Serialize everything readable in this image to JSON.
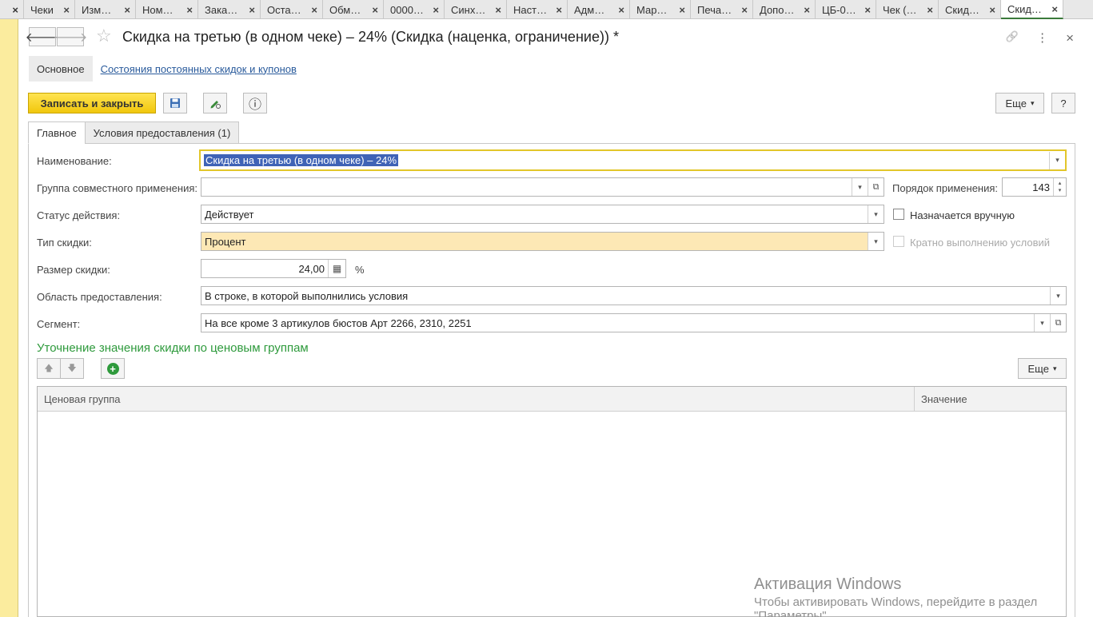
{
  "window_tabs": [
    {
      "label": "Чеки",
      "active": false
    },
    {
      "label": "Изм…",
      "active": false
    },
    {
      "label": "Ном…",
      "active": false
    },
    {
      "label": "Зака…",
      "active": false
    },
    {
      "label": "Оста…",
      "active": false
    },
    {
      "label": "Обм…",
      "active": false
    },
    {
      "label": "0000…",
      "active": false
    },
    {
      "label": "Синх…",
      "active": false
    },
    {
      "label": "Наст…",
      "active": false
    },
    {
      "label": "Адм…",
      "active": false
    },
    {
      "label": "Мар…",
      "active": false
    },
    {
      "label": "Печа…",
      "active": false
    },
    {
      "label": "Допо…",
      "active": false
    },
    {
      "label": "ЦБ-0…",
      "active": false
    },
    {
      "label": "Чек (…",
      "active": false
    },
    {
      "label": "Скид…",
      "active": false
    },
    {
      "label": "Скид…",
      "active": true
    }
  ],
  "tab_close_glyph": "×",
  "header": {
    "back_glyph": "🡐",
    "forward_glyph": "🡒",
    "star_glyph": "☆",
    "title": "Скидка  на третью (в одном чеке) – 24% (Скидка (наценка, ограничение)) *",
    "link_glyph": "🔗",
    "menu_glyph": "⋮",
    "close_glyph": "×"
  },
  "section_tabs": [
    {
      "label": "Основное",
      "active": true
    },
    {
      "label": "Состояния постоянных скидок и купонов",
      "active": false
    }
  ],
  "toolbar": {
    "save_close_label": "Записать и закрыть",
    "save_icon": "floppy-disk-icon",
    "edit_icon": "pen-icon",
    "info_glyph": "ⓘ",
    "more_label": "Еще",
    "help_label": "?"
  },
  "form_tabs": [
    {
      "label": "Главное",
      "active": true
    },
    {
      "label": "Условия предоставления (1)",
      "active": false
    }
  ],
  "fields": {
    "name": {
      "label": "Наименование:",
      "value": "Скидка  на третью (в одном чеке) – 24%"
    },
    "group": {
      "label": "Группа совместного применения:",
      "value": ""
    },
    "order": {
      "label": "Порядок применения:",
      "value": "143"
    },
    "status": {
      "label": "Статус действия:",
      "value": "Действует"
    },
    "manual": {
      "label": "Назначается вручную",
      "checked": false
    },
    "type": {
      "label": "Тип скидки:",
      "value": "Процент"
    },
    "multiple": {
      "label": "Кратно выполнению условий",
      "checked": false,
      "disabled": true
    },
    "size": {
      "label": "Размер скидки:",
      "value": "24,00",
      "unit": "%"
    },
    "area": {
      "label": "Область предоставления:",
      "value": "В строке, в которой выполнились условия"
    },
    "segment": {
      "label": "Сегмент:",
      "value": "На все кроме 3 артикулов бюстов Арт 2266, 2310, 2251"
    }
  },
  "dropdown_glyph": "▾",
  "open_glyph": "⧉",
  "spin_up_glyph": "▴",
  "spin_down_glyph": "▾",
  "calc_glyph": "▦",
  "price_groups": {
    "title": "Уточнение значения скидки по ценовым группам",
    "up_glyph": "🡅",
    "down_glyph": "🡇",
    "add_glyph": "+",
    "more_label": "Еще",
    "columns": [
      "Ценовая группа",
      "Значение"
    ],
    "rows": []
  },
  "watermark": {
    "line1": "Активация Windows",
    "line2": "Чтобы активировать Windows, перейдите в раздел",
    "line3": "\"Параметры\"."
  },
  "left_strip_glyph": ")",
  "colors": {
    "accent_yellow": "#f5cf1c",
    "left_strip": "#fbec9e",
    "section_title": "#2e9a3c",
    "highlight_orange": "#fde8b5",
    "selection_blue": "#3f63b6"
  }
}
